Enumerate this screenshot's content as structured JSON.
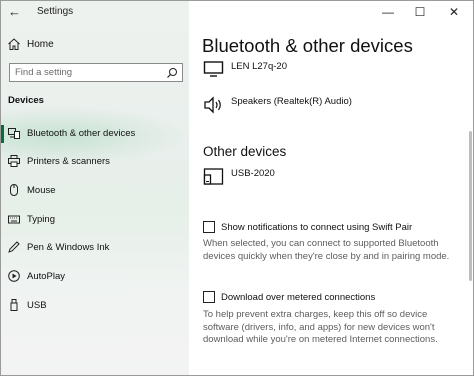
{
  "window": {
    "title": "Settings"
  },
  "titlebar": {
    "back_glyph": "←",
    "minimize_glyph": "—",
    "maximize_glyph": "☐",
    "close_glyph": "✕"
  },
  "sidebar": {
    "home_label": "Home",
    "search_placeholder": "Find a setting",
    "section_label": "Devices",
    "items": [
      {
        "label": "Bluetooth & other devices",
        "icon": "bluetooth-devices-icon",
        "selected": true
      },
      {
        "label": "Printers & scanners",
        "icon": "printer-icon",
        "selected": false
      },
      {
        "label": "Mouse",
        "icon": "mouse-icon",
        "selected": false
      },
      {
        "label": "Typing",
        "icon": "keyboard-icon",
        "selected": false
      },
      {
        "label": "Pen & Windows Ink",
        "icon": "pen-icon",
        "selected": false
      },
      {
        "label": "AutoPlay",
        "icon": "autoplay-icon",
        "selected": false
      },
      {
        "label": "USB",
        "icon": "usb-icon",
        "selected": false
      }
    ]
  },
  "main": {
    "title": "Bluetooth & other devices",
    "devices": [
      {
        "name": "LEN L27q-20",
        "icon": "monitor-icon"
      },
      {
        "name": "Speakers (Realtek(R) Audio)",
        "icon": "speaker-icon"
      }
    ],
    "other_devices_heading": "Other devices",
    "other_devices": [
      {
        "name": "USB-2020",
        "icon": "generic-device-icon"
      }
    ],
    "swift_pair": {
      "label": "Show notifications to connect using Swift Pair",
      "checked": false,
      "help": "When selected, you can connect to supported Bluetooth devices quickly when they're close by and in pairing mode."
    },
    "metered": {
      "label": "Download over metered connections",
      "checked": false,
      "help": "To help prevent extra charges, keep this off so device software (drivers, info, and apps) for new devices won't download while you're on metered Internet connections."
    }
  },
  "colors": {
    "accent": "#0a6b3f",
    "sidebar_bg": "#eef2ef"
  }
}
